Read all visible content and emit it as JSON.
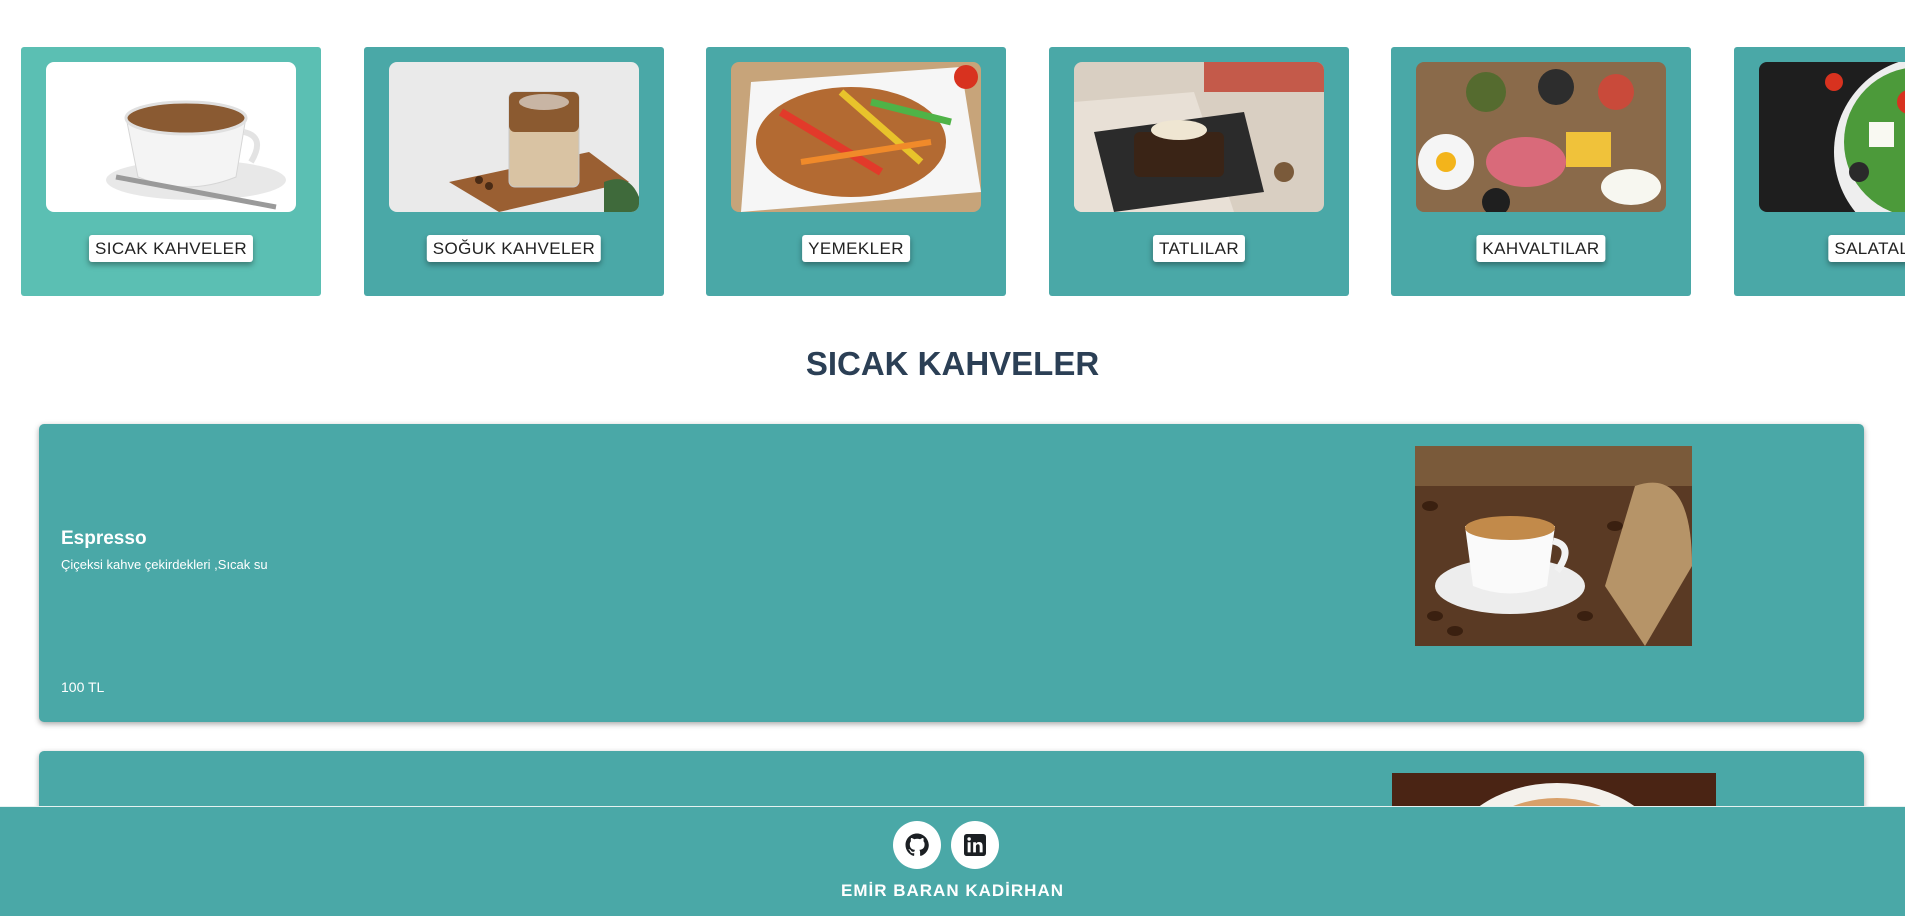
{
  "categories": [
    {
      "label": "SICAK KAHVELER",
      "image": "hot-coffee-cup-image",
      "active": true
    },
    {
      "label": "SOĞUK KAHVELER",
      "image": "iced-coffee-glass-image",
      "active": false
    },
    {
      "label": "YEMEKLER",
      "image": "chicken-stir-fry-plate-image",
      "active": false
    },
    {
      "label": "TATLILAR",
      "image": "chocolate-dessert-image",
      "active": false
    },
    {
      "label": "KAHVALTILAR",
      "image": "breakfast-spread-image",
      "active": false
    },
    {
      "label": "SALATALAR",
      "image": "greek-salad-image",
      "active": false
    }
  ],
  "section": {
    "title": "SICAK KAHVELER"
  },
  "products": [
    {
      "name": "Espresso",
      "description": "Çiçeksi kahve çekirdekleri ,Sıcak su",
      "price": "100 TL",
      "image": "espresso-with-coffee-beans-image"
    },
    {
      "image": "latte-art-cup-image"
    }
  ],
  "footer": {
    "icons": [
      "github-icon",
      "linkedin-icon"
    ],
    "name": "EMİR BARAN KADİRHAN"
  },
  "colors": {
    "teal": "#4aa8a7",
    "active_teal": "#5bbfb3",
    "title": "#2b3f55"
  }
}
